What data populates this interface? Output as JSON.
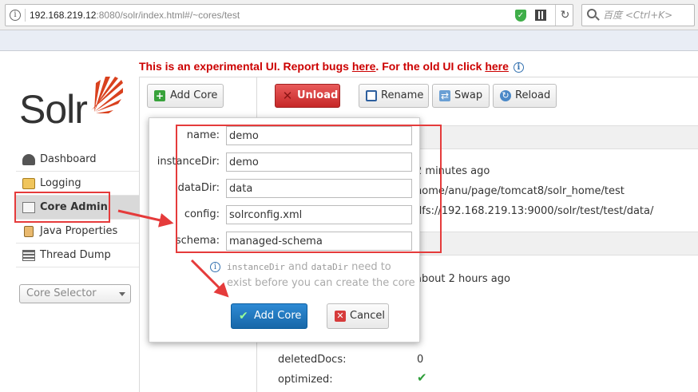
{
  "browser": {
    "url_host": "192.168.219.12",
    "url_rest": ":8080/solr/index.html#/~cores/test",
    "search_placeholder": "百度 <Ctrl+K>"
  },
  "banner": {
    "prefix": "This is an experimental UI. Report bugs ",
    "link1": "here",
    "middle": ". For the old UI click ",
    "link2": "here"
  },
  "logo": {
    "text": "Solr"
  },
  "sidebar": {
    "items": [
      {
        "label": "Dashboard",
        "icon": "dashboard-icon"
      },
      {
        "label": "Logging",
        "icon": "logging-icon"
      },
      {
        "label": "Core Admin",
        "icon": "core-admin-icon",
        "active": true
      },
      {
        "label": "Java Properties",
        "icon": "java-properties-icon"
      },
      {
        "label": "Thread Dump",
        "icon": "thread-dump-icon"
      }
    ],
    "core_selector": "Core Selector"
  },
  "toolbar": {
    "add_core": "Add Core",
    "unload": "Unload",
    "rename": "Rename",
    "swap": "Swap",
    "reload": "Reload"
  },
  "details": {
    "start_time": "2 minutes ago",
    "instance_dir": "home/anu/page/tomcat8/solr_home/test",
    "data_dir": "dfs://192.168.219.13:9000/solr/test/test/data/",
    "last_modified": "about 2 hours ago",
    "deleted_docs_label": "deletedDocs:",
    "deleted_docs_value": "0",
    "optimized_label": "optimized:"
  },
  "dialog": {
    "fields": [
      {
        "label": "name:",
        "value": "demo"
      },
      {
        "label": "instanceDir:",
        "value": "demo"
      },
      {
        "label": "dataDir:",
        "value": "data"
      },
      {
        "label": "config:",
        "value": "solrconfig.xml"
      },
      {
        "label": "schema:",
        "value": "managed-schema"
      }
    ],
    "note_code1": "instanceDir",
    "note_and": " and ",
    "note_code2": "dataDir",
    "note_rest": " need to exist before you can create the core",
    "add_core": "Add Core",
    "cancel": "Cancel"
  },
  "colors": {
    "annotation_red": "#e53b3b",
    "banner_red": "#cc0000",
    "primary_blue": "#1f77bf",
    "unload_red": "#d63b3b"
  }
}
